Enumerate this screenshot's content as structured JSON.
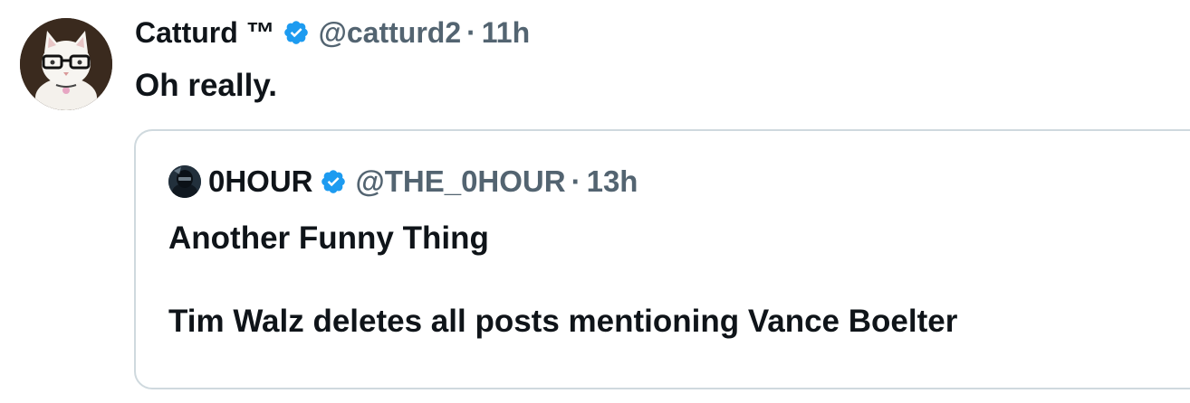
{
  "tweet": {
    "display_name": "Catturd ™",
    "handle": "@catturd2",
    "separator": "·",
    "time": "11h",
    "text": "Oh really.",
    "avatar_icon": "cat-with-glasses-avatar",
    "badge_icon": "verified-badge-icon"
  },
  "quoted_tweet": {
    "display_name": "0HOUR",
    "handle": "@THE_0HOUR",
    "separator": "·",
    "time": "13h",
    "text_line_1": "Another Funny Thing",
    "text_line_2": "Tim Walz deletes all posts mentioning Vance Boelter",
    "avatar_icon": "masked-figure-avatar",
    "badge_icon": "verified-badge-icon"
  },
  "colors": {
    "primary_text": "#0f1419",
    "secondary_text": "#536471",
    "verified_blue": "#1d9bf0",
    "card_border": "#cfd9de"
  }
}
